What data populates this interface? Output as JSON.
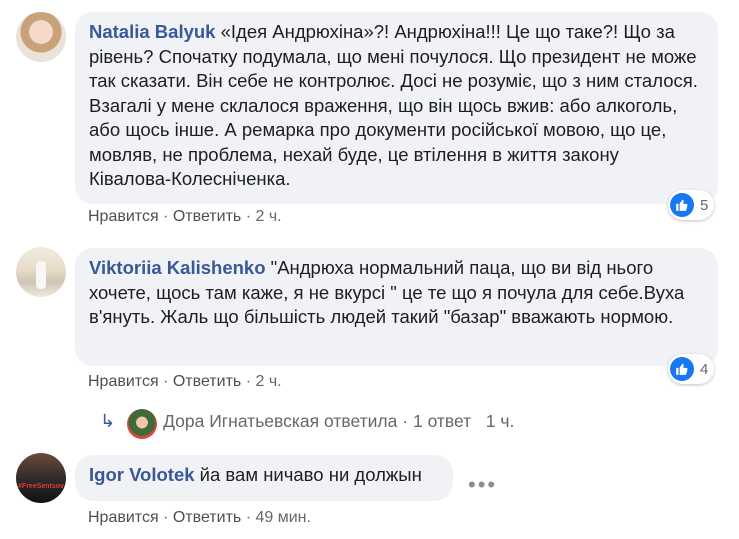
{
  "comments": [
    {
      "author": "Natalia Balyuk",
      "text": "«Ідея Андрюхіна»?! Андрюхіна!!! Це що таке?! Що за рівень? Спочатку подумала, що мені почулося. Що президент не може так сказати. Він себе не контролює. Досі не розуміє, що з ним сталося. Взагалі у мене склалося враження, що він щось вжив: або алкоголь, або щось інше. А ремарка про документи російської мовою, що це, мовляв, не проблема, нехай буде, це втілення в життя закону Ківалова-Колесніченка.",
      "like_label": "Нравится",
      "reply_label": "Ответить",
      "time": "2 ч.",
      "reactions": "5"
    },
    {
      "author": "Viktoriia Kalishenko",
      "text": "\"Андрюха нормальний паца, що ви від нього хочете, щось там каже, я не вкурсі \" це те що я почула для себе.Вуха в'януть. Жаль що більшість людей такий \"базар\" вважають нормою.",
      "like_label": "Нравится",
      "reply_label": "Ответить",
      "time": "2 ч.",
      "reactions": "4",
      "replies": {
        "author": "Дора Игнатьевская",
        "replied": "ответила",
        "count": "1 ответ",
        "time": "1 ч."
      }
    },
    {
      "author": "Igor Volotek",
      "text": "йа вам ничаво ни должын",
      "like_label": "Нравится",
      "reply_label": "Ответить",
      "time": "49 мин.",
      "avatar_text": "#FreeSentsov"
    }
  ],
  "separator": "·",
  "colors": {
    "author": "#385898",
    "like": "#1877f2",
    "bubble": "#f0f2f5"
  },
  "icons": {
    "like": "thumbs-up-icon",
    "reply_arrow": "reply-arrow-icon",
    "more": "more-dots-icon"
  }
}
